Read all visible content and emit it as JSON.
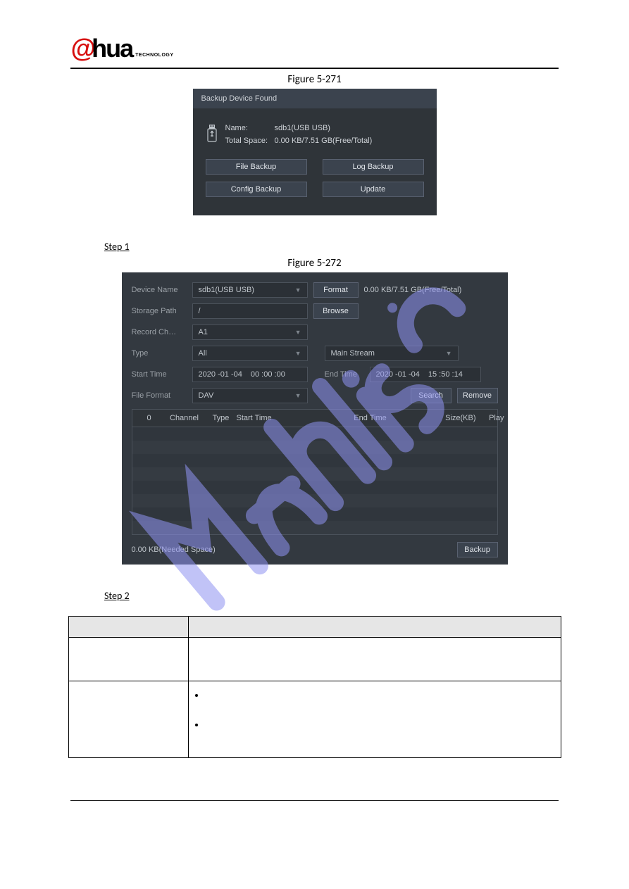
{
  "header": {
    "logo_at": "@",
    "logo_hua": "hua",
    "logo_sub": "TECHNOLOGY"
  },
  "figure271": {
    "caption": "Figure 5-271",
    "title": "Backup Device Found",
    "name_label": "Name:",
    "name_value": "sdb1(USB USB)",
    "space_label": "Total Space:",
    "space_value": "0.00 KB/7.51 GB(Free/Total)",
    "buttons": {
      "file_backup": "File Backup",
      "log_backup": "Log Backup",
      "config_backup": "Config Backup",
      "update": "Update"
    }
  },
  "step1": "Step 1",
  "figure272": {
    "caption": "Figure 5-272",
    "device_name": {
      "label": "Device Name",
      "value": "sdb1(USB USB)",
      "format_btn": "Format",
      "summary": "0.00 KB/7.51 GB(Free/Total)"
    },
    "storage_path": {
      "label": "Storage Path",
      "value": "/",
      "browse_btn": "Browse"
    },
    "record_ch": {
      "label": "Record Ch…",
      "value": "A1"
    },
    "type": {
      "label": "Type",
      "value": "All",
      "stream": "Main Stream"
    },
    "start_time": {
      "label": "Start Time",
      "date": "2020 -01 -04",
      "time": "00 :00 :00"
    },
    "end_time": {
      "label": "End Time",
      "date": "2020 -01 -04",
      "time": "15 :50 :14"
    },
    "file_format": {
      "label": "File Format",
      "value": "DAV",
      "search_btn": "Search",
      "remove_btn": "Remove"
    },
    "table": {
      "cols": {
        "idx": "0",
        "channel": "Channel",
        "type": "Type",
        "start": "Start Time",
        "end": "End Time",
        "size": "Size(KB)",
        "play": "Play"
      }
    },
    "needed_space": "0.00 KB(Needed Space)",
    "backup_btn": "Backup"
  },
  "step2": "Step 2"
}
